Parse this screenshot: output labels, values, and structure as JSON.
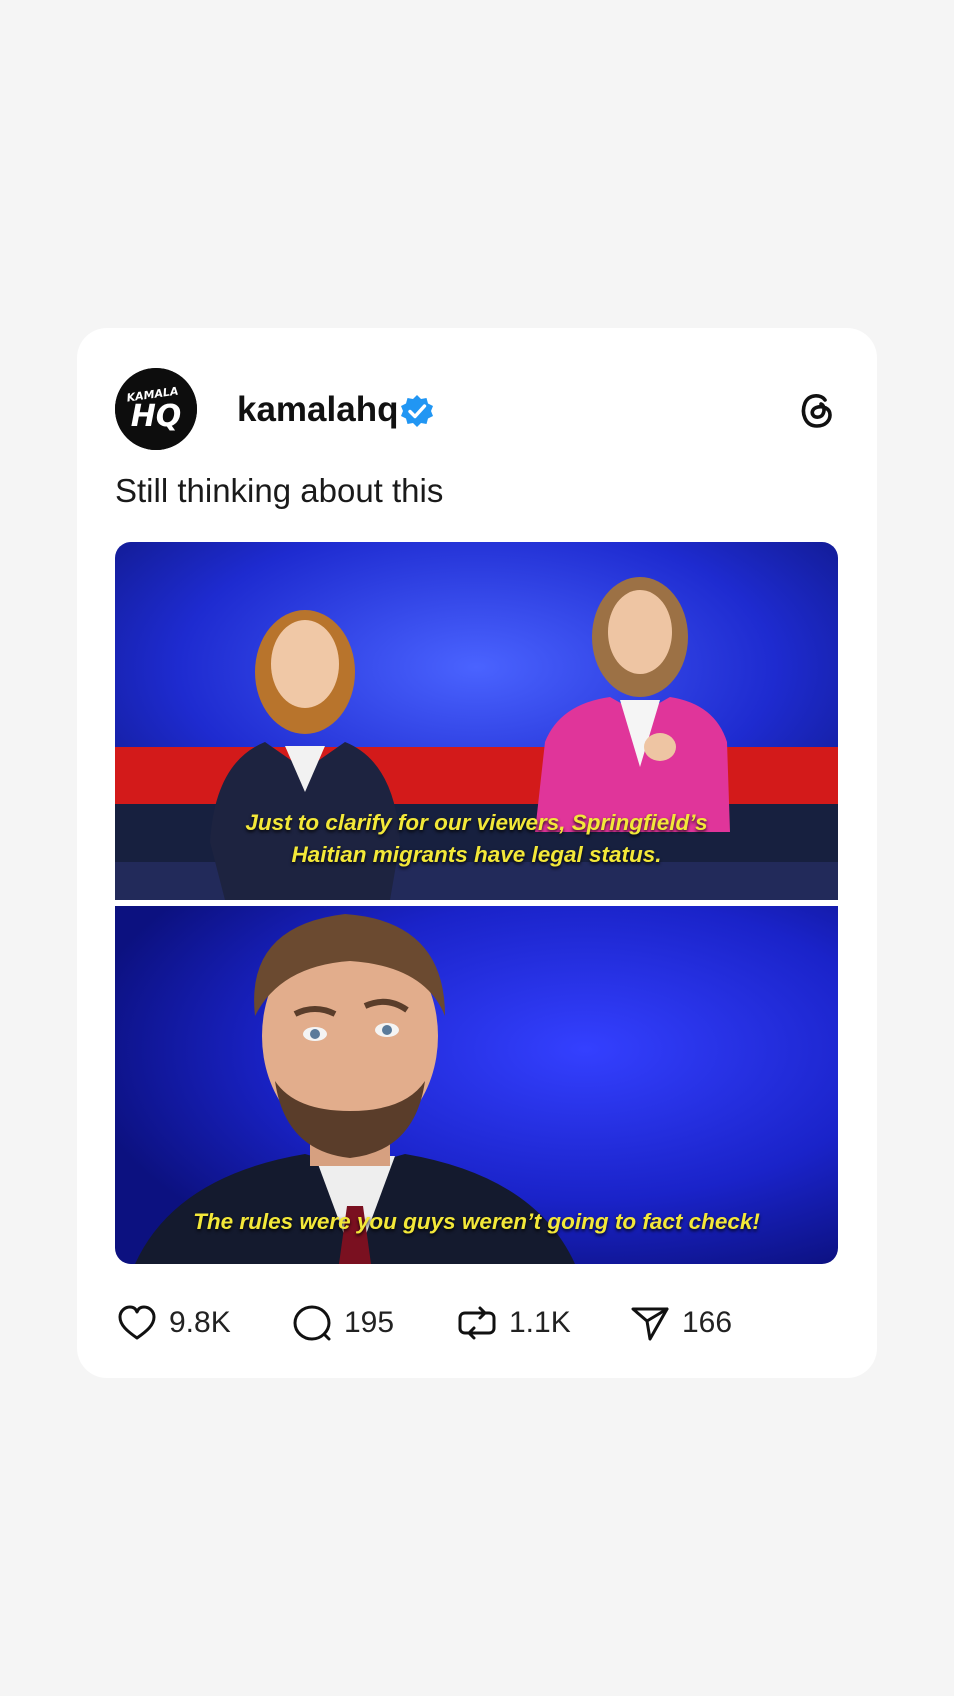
{
  "post": {
    "author": {
      "username": "kamalahq",
      "avatar_text_top": "KAMALA",
      "avatar_text_main": "HQ",
      "verified_icon": "verified-badge-icon"
    },
    "app_icon": "threads-logo-icon",
    "text": "Still thinking about this",
    "media": {
      "frame1_caption": "Just to clarify for our viewers, Springfield’s\nHaitian migrants have legal status.",
      "frame2_caption": "The rules were you guys weren’t going to fact check!"
    },
    "actions": {
      "likes": "9.8K",
      "replies": "195",
      "reposts": "1.1K",
      "shares": "166"
    }
  },
  "colors": {
    "background": "#f5f5f5",
    "card": "#ffffff",
    "verified": "#2196f3",
    "caption": "#f3e839",
    "studio_blue": "#1e2bd0",
    "desk_red": "#d31a1a"
  }
}
